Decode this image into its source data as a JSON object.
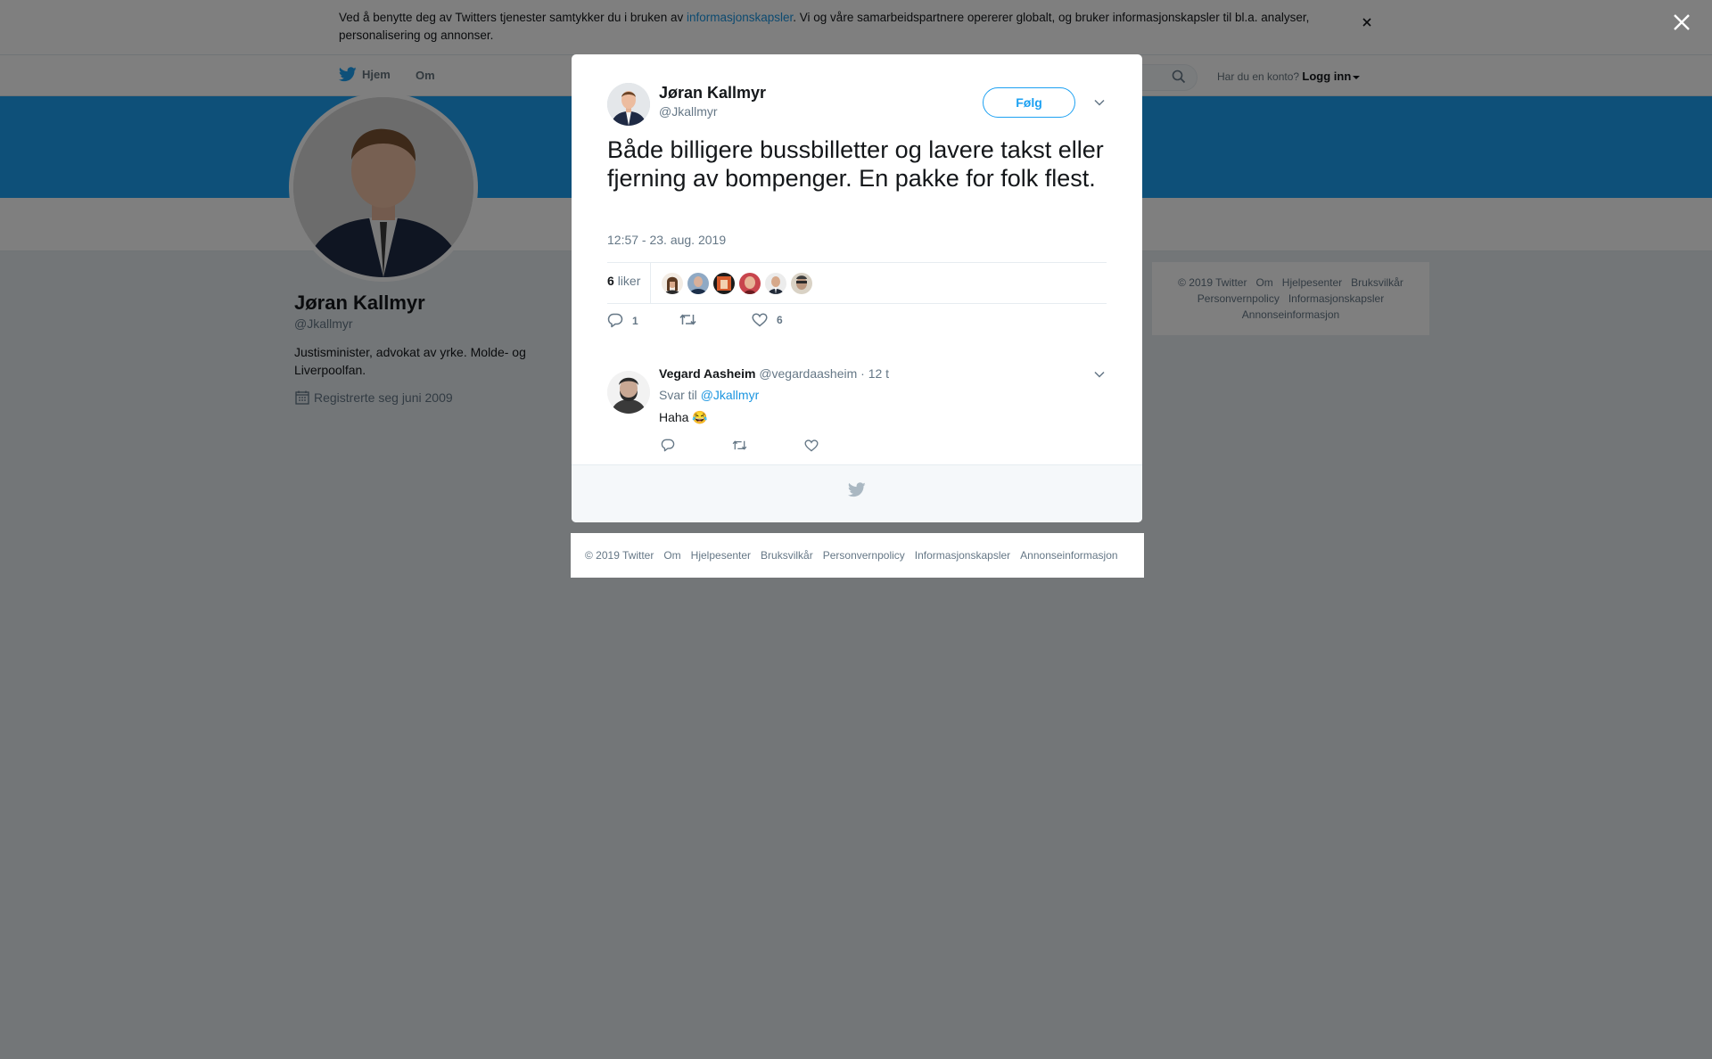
{
  "cookie_banner": {
    "text_before": "Ved å benytte deg av Twitters tjenester samtykker du i bruken av ",
    "link": "informasjonskapsler",
    "text_after": ". Vi og våre samarbeidspartnere opererer globalt, og bruker informasjonskapsler til bl.a. analyser, personalisering og annonser.",
    "close_icon": "close-icon"
  },
  "topnav": {
    "home": "Hjem",
    "about": "Om",
    "account_question": "Har du en konto?",
    "login": "Logg inn"
  },
  "profile": {
    "name": "Jøran Kallmyr",
    "handle": "@Jkallmyr",
    "bio": "Justisminister, advokat av yrke. Molde- og Liverpoolfan.",
    "joined": "Registrerte seg juni 2009"
  },
  "side_footer": {
    "links": [
      "© 2019 Twitter",
      "Om",
      "Hjelpesenter",
      "Bruksvilkår",
      "Personvernpolicy",
      "Informasjonskapsler",
      "Annonseinformasjon"
    ]
  },
  "tweet": {
    "author_name": "Jøran Kallmyr",
    "author_handle": "@Jkallmyr",
    "follow_label": "Følg",
    "text": "Både billigere bussbilletter og lavere takst eller fjerning av bompenger. En pakke for folk flest.",
    "timestamp": "12:57 - 23. aug. 2019",
    "likes_count": "6",
    "likes_label": "liker",
    "reply_count": "1",
    "retweet_count": "",
    "like_count": "6"
  },
  "reply": {
    "name": "Vegard Aasheim",
    "handle": "@vegardaasheim",
    "separator": "·",
    "time": "12 t",
    "reply_to_prefix": "Svar til",
    "reply_to_handle": "@Jkallmyr",
    "text": "Haha 😂"
  },
  "modal_footer": {
    "links": [
      "© 2019 Twitter",
      "Om",
      "Hjelpesenter",
      "Bruksvilkår",
      "Personvernpolicy",
      "Informasjonskapsler",
      "Annonseinformasjon"
    ]
  },
  "colors": {
    "accent": "#1da1f2",
    "link": "#1b95e0",
    "muted": "#657786",
    "text": "#14171a"
  },
  "icons": [
    "twitter-bird-icon",
    "search-icon",
    "calendar-icon",
    "reply-icon",
    "retweet-icon",
    "heart-icon",
    "chevron-down-icon",
    "close-icon"
  ]
}
